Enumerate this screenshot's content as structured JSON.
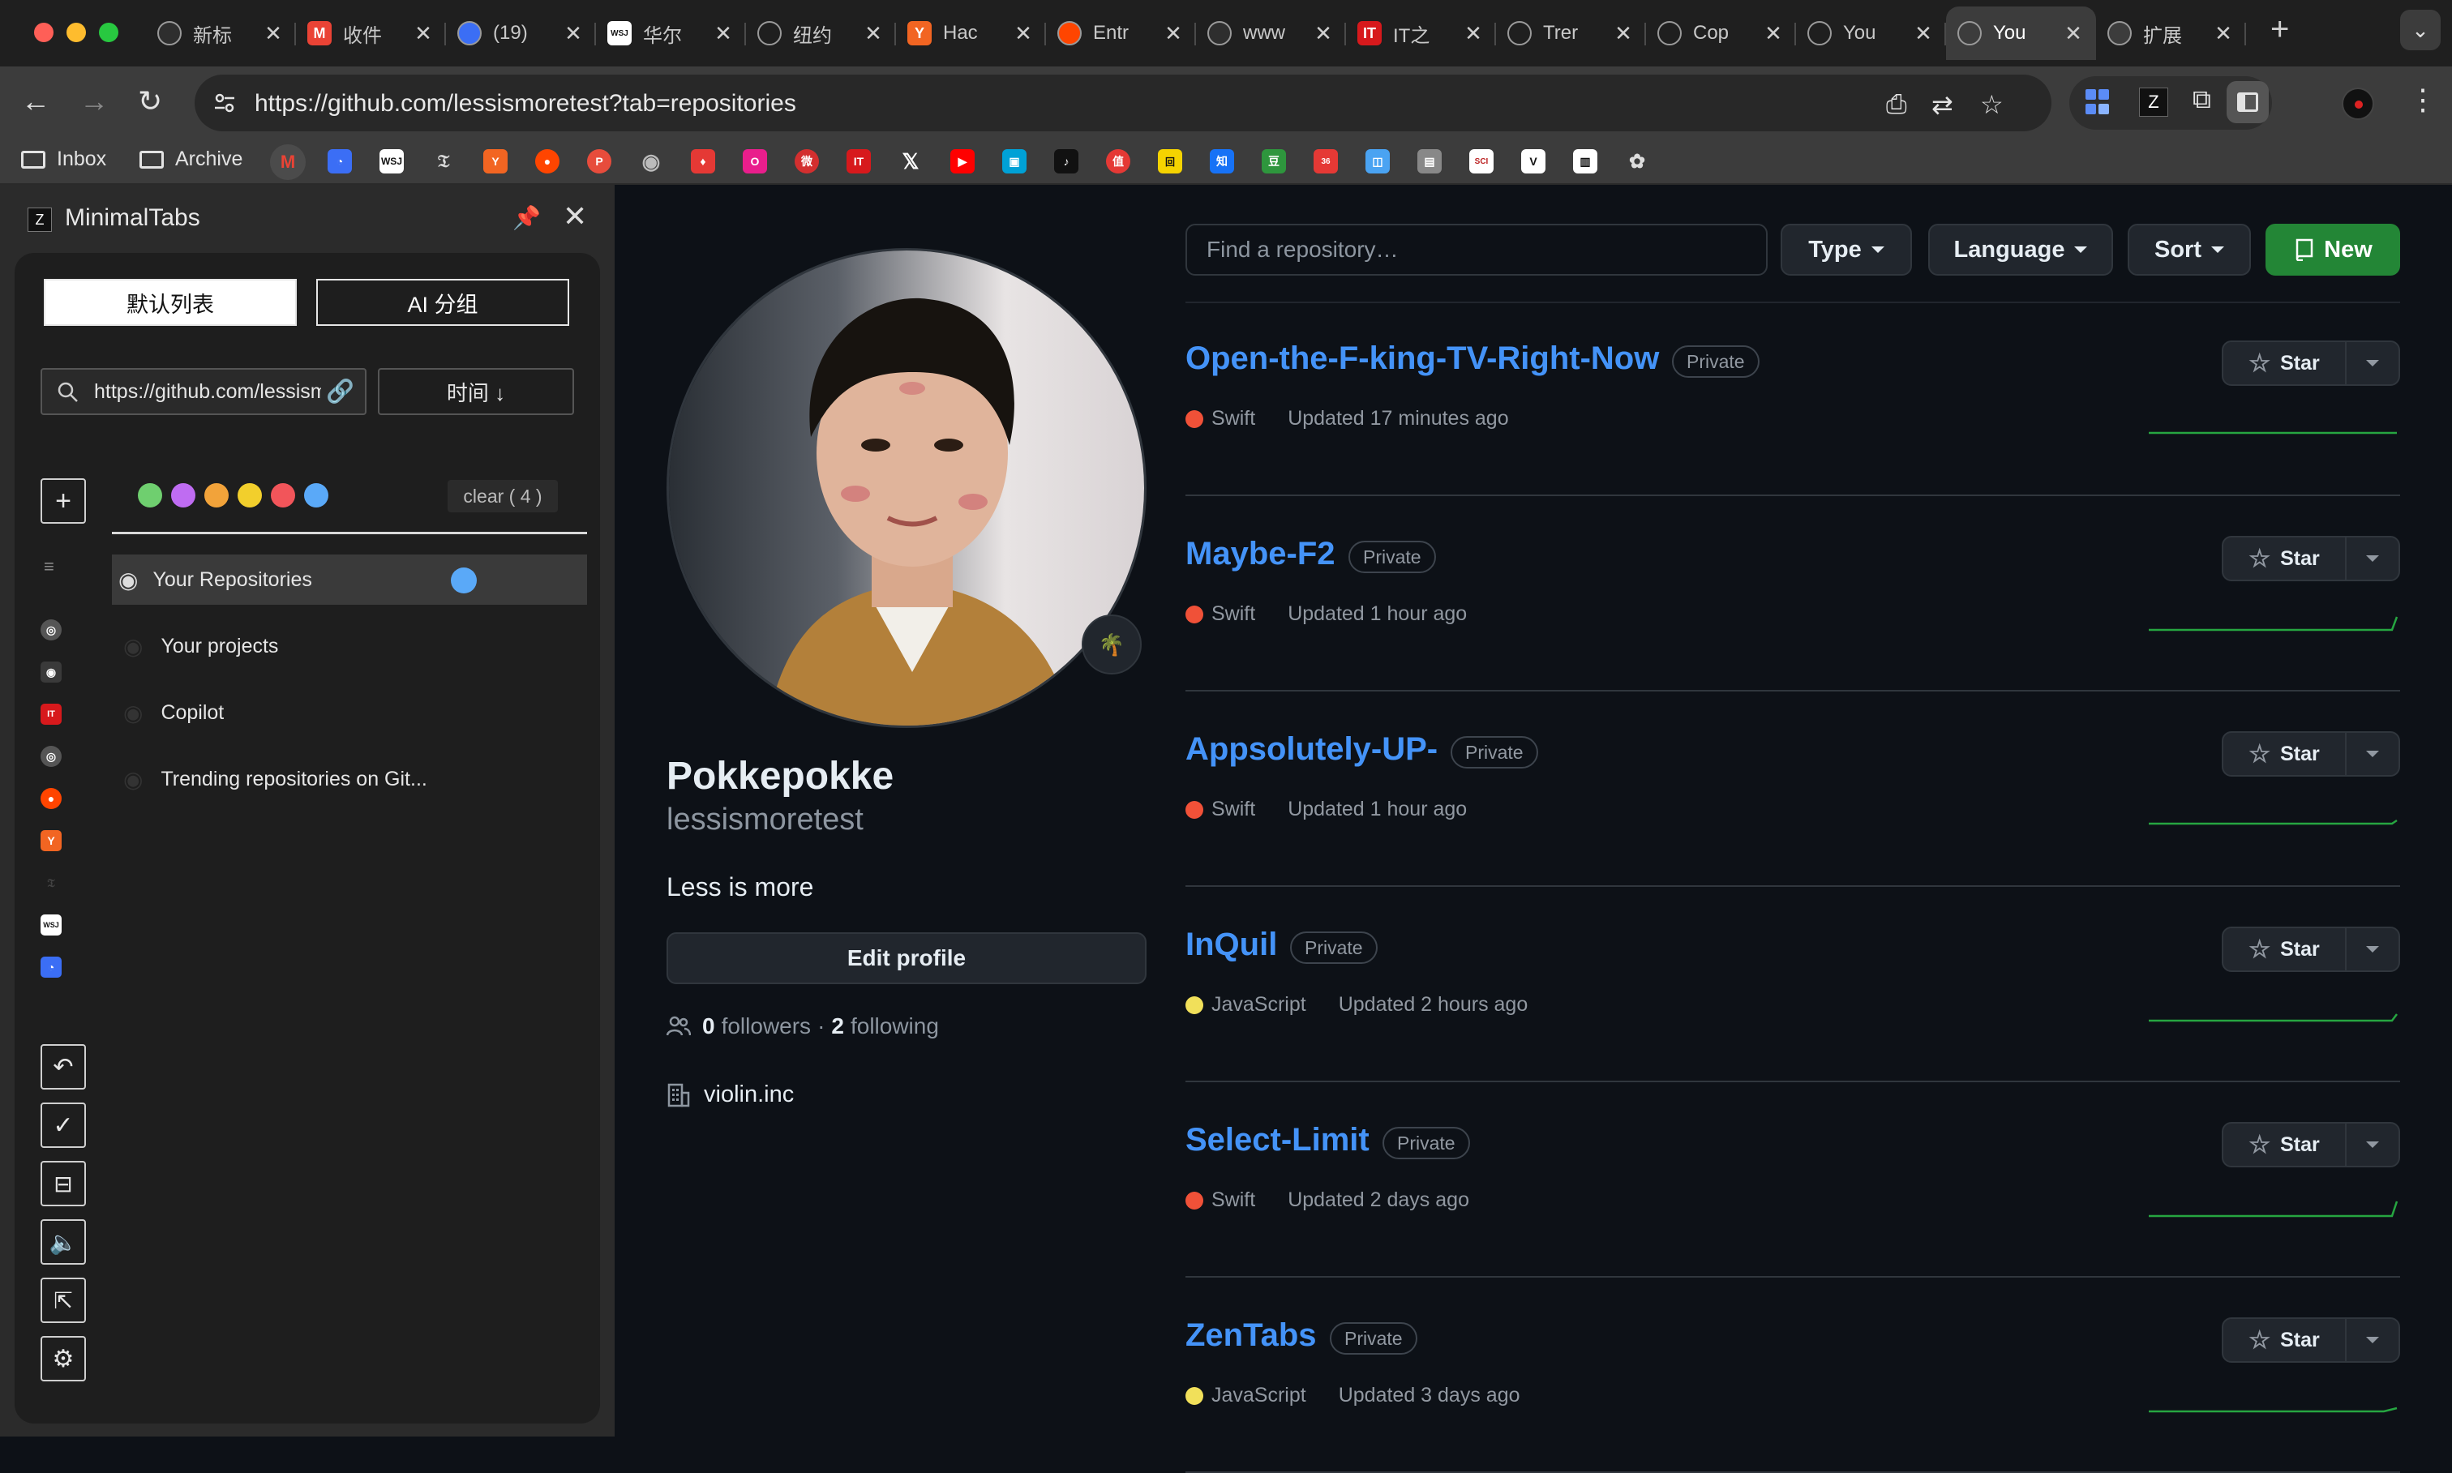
{
  "browser": {
    "tabs": [
      {
        "title": "新标",
        "icon": "chrome-icon",
        "color": "#2e2e2e",
        "glyph": ""
      },
      {
        "title": "收件",
        "icon": "gmail-icon",
        "color": "#ea4335",
        "glyph": "M"
      },
      {
        "title": "(19)",
        "icon": "clock-icon",
        "color": "#3b6ef5",
        "glyph": ""
      },
      {
        "title": "华尔",
        "icon": "wsj-icon",
        "color": "#ffffff",
        "glyph": "WSJ"
      },
      {
        "title": "纽约",
        "icon": "nyt-icon",
        "color": "#1f1f1f",
        "glyph": ""
      },
      {
        "title": "Hac",
        "icon": "ycombinator-icon",
        "color": "#f26522",
        "glyph": "Y"
      },
      {
        "title": "Entr",
        "icon": "reddit-icon",
        "color": "#ff4500",
        "glyph": ""
      },
      {
        "title": "www",
        "icon": "globe-icon",
        "color": "#2e2e2e",
        "glyph": ""
      },
      {
        "title": "IT之",
        "icon": "ithome-icon",
        "color": "#d7191c",
        "glyph": "IT"
      },
      {
        "title": "Trer",
        "icon": "github-icon",
        "color": "#1f1f1f",
        "glyph": ""
      },
      {
        "title": "Cop",
        "icon": "github-icon",
        "color": "#1f1f1f",
        "glyph": ""
      },
      {
        "title": "You",
        "icon": "github-icon",
        "color": "#1f1f1f",
        "glyph": ""
      },
      {
        "title": "You",
        "icon": "github-icon",
        "color": "#3c3c3c",
        "glyph": "",
        "active": true
      },
      {
        "title": "扩展",
        "icon": "puzzle-icon",
        "color": "#3c3c3c",
        "glyph": ""
      }
    ],
    "url": "https://github.com/lessismoretest?tab=repositories",
    "bookmarks": {
      "inbox": "Inbox",
      "archive": "Archive"
    }
  },
  "sidepanel": {
    "title": "MinimalTabs",
    "seg_default": "默认列表",
    "seg_ai": "AI 分组",
    "search_value": "https://github.com/lessismoretest",
    "sort_label": "时间 ↓",
    "clear_label": "clear ( 4 )",
    "color_dots": [
      "#6fcf6f",
      "#bf6cf2",
      "#f2a33a",
      "#f2cf2c",
      "#f2555a",
      "#5aa9f8"
    ],
    "items": [
      {
        "label": "Your Repositories",
        "selected": true
      },
      {
        "label": "Your projects"
      },
      {
        "label": "Copilot"
      },
      {
        "label": "Trending repositories on Git..."
      }
    ]
  },
  "profile": {
    "name": "Pokkepokke",
    "login": "lessismoretest",
    "bio": "Less is more",
    "edit_label": "Edit profile",
    "followers_count": "0",
    "followers_label": "followers",
    "separator": "·",
    "following_count": "2",
    "following_label": "following",
    "org": "violin.inc",
    "status_emoji": "🌴"
  },
  "filters": {
    "search_placeholder": "Find a repository…",
    "type": "Type",
    "language": "Language",
    "sort": "Sort",
    "new": "New"
  },
  "repos": [
    {
      "name": "Open-the-F-king-TV-Right-Now",
      "visibility": "Private",
      "language": "Swift",
      "lang_color": "#f05138",
      "updated": "Updated 17 minutes ago",
      "star": "Star"
    },
    {
      "name": "Maybe-F2",
      "visibility": "Private",
      "language": "Swift",
      "lang_color": "#f05138",
      "updated": "Updated 1 hour ago",
      "star": "Star"
    },
    {
      "name": "Appsolutely-UP-",
      "visibility": "Private",
      "language": "Swift",
      "lang_color": "#f05138",
      "updated": "Updated 1 hour ago",
      "star": "Star"
    },
    {
      "name": "InQuil",
      "visibility": "Private",
      "language": "JavaScript",
      "lang_color": "#f1e05a",
      "updated": "Updated 2 hours ago",
      "star": "Star"
    },
    {
      "name": "Select-Limit",
      "visibility": "Private",
      "language": "Swift",
      "lang_color": "#f05138",
      "updated": "Updated 2 days ago",
      "star": "Star"
    },
    {
      "name": "ZenTabs",
      "visibility": "Private",
      "language": "JavaScript",
      "lang_color": "#f1e05a",
      "updated": "Updated 3 days ago",
      "star": "Star"
    }
  ]
}
